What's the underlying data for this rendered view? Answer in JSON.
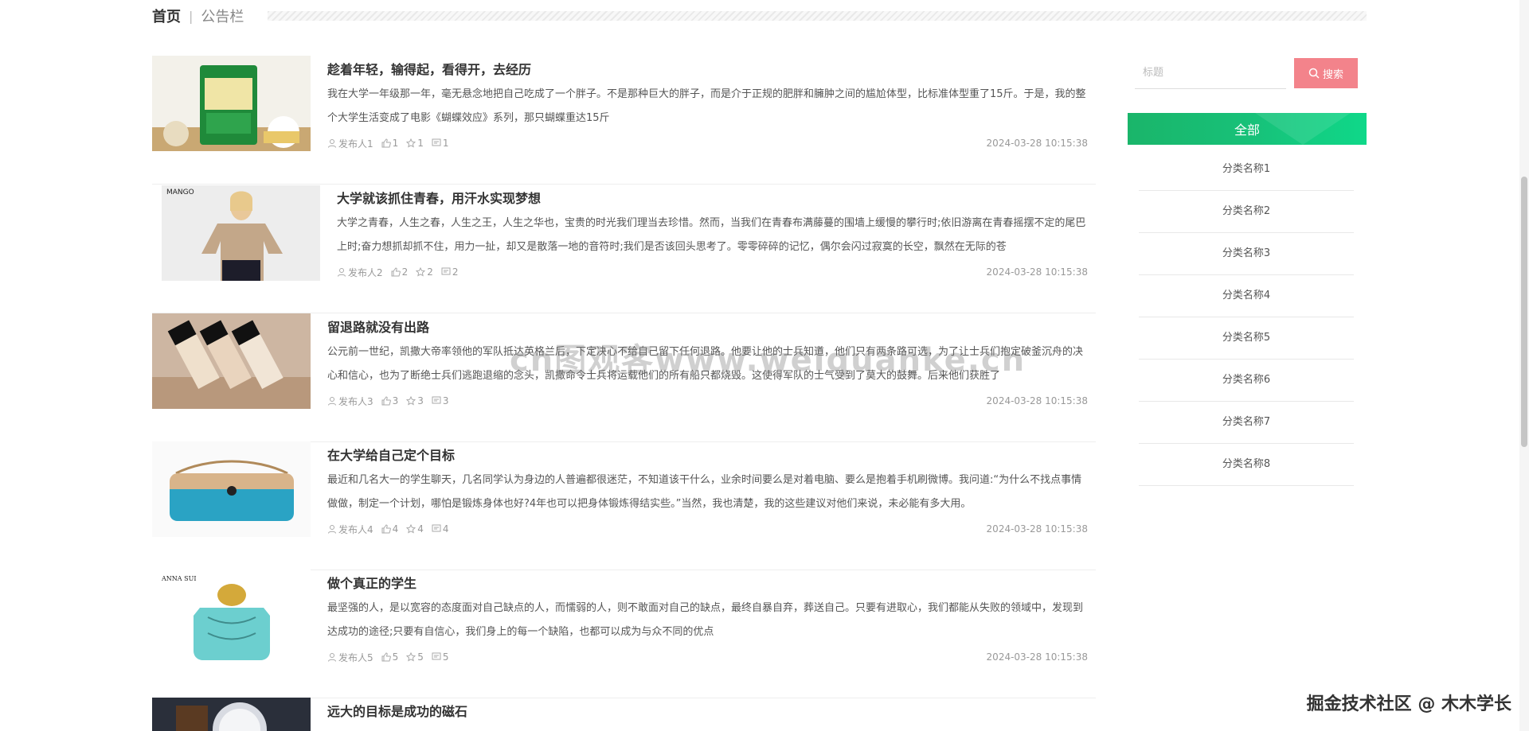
{
  "breadcrumb": {
    "home": "首页",
    "separator": "|",
    "current": "公告栏"
  },
  "articles": [
    {
      "title": "趁着年轻，输得起，看得开，去经历",
      "desc": "我在大学一年级那一年，毫无悬念地把自己吃成了一个胖子。不是那种巨大的胖子，而是介于正规的肥胖和臃肿之间的尴尬体型，比标准体型重了15斤。于是，我的整个大学生活变成了电影《蝴蝶效应》系列，那只蝴蝶重达15斤",
      "author": "发布人1",
      "likes": "1",
      "favs": "1",
      "comments": "1",
      "date": "2024-03-28 10:15:38",
      "thumb_icon": "oil-bottle-image"
    },
    {
      "title": "大学就该抓住青春，用汗水实现梦想",
      "desc": "大学之青春，人生之春，人生之王，人生之华也，宝贵的时光我们理当去珍惜。然而，当我们在青春布满藤蔓的围墙上缓慢的攀行时;依旧游离在青春摇摆不定的尾巴上时;奋力想抓却抓不住，用力一扯，却又是散落一地的音符时;我们是否该回头思考了。零零碎碎的记忆，偶尔会闪过寂寞的长空，飘然在无际的苍",
      "author": "发布人2",
      "likes": "2",
      "favs": "2",
      "comments": "2",
      "date": "2024-03-28 10:15:38",
      "thumb_icon": "fashion-model-image",
      "thumb_label": "MANGO"
    },
    {
      "title": "留退路就没有出路",
      "desc": "公元前一世纪，凯撒大帝率领他的军队抵达英格兰后，下定决心不给自己留下任何退路。他要让他的士兵知道，他们只有两条路可选，为了让士兵们抱定破釜沉舟的决心和信心，也为了断绝士兵们逃跑退缩的念头，凯撒命令士兵将运载他们的所有船只都烧毁。这使得军队的士气受到了莫大的鼓舞。后来他们获胜了",
      "author": "发布人3",
      "likes": "3",
      "favs": "3",
      "comments": "3",
      "date": "2024-03-28 10:15:38",
      "thumb_icon": "cosmetics-bottles-image"
    },
    {
      "title": "在大学给自己定个目标",
      "desc": "最近和几名大一的学生聊天，几名同学认为身边的人普遍都很迷茫，不知道该干什么，业余时间要么是对着电脑、要么是抱着手机刷微博。我问道:“为什么不找点事情做做，制定一个计划，哪怕是锻炼身体也好?4年也可以把身体锻炼得结实些。”当然，我也清楚，我的这些建议对他们来说，未必能有多大用。",
      "author": "发布人4",
      "likes": "4",
      "favs": "4",
      "comments": "4",
      "date": "2024-03-28 10:15:38",
      "thumb_icon": "handbag-image"
    },
    {
      "title": "做个真正的学生",
      "desc": "最坚强的人，是以宽容的态度面对自己缺点的人，而懦弱的人，则不敢面对自己的缺点，最终自暴自弃，葬送自己。只要有进取心，我们都能从失败的领域中，发现到达成功的途径;只要有自信心，我们身上的每一个缺陷，也都可以成为与众不同的优点",
      "author": "发布人5",
      "likes": "5",
      "favs": "5",
      "comments": "5",
      "date": "2024-03-28 10:15:38",
      "thumb_icon": "perfume-bottle-image",
      "thumb_label": "ANNA SUI"
    },
    {
      "title": "远大的目标是成功的磁石",
      "desc": "",
      "author": "",
      "likes": "",
      "favs": "",
      "comments": "",
      "date": "",
      "thumb_icon": "watch-image"
    }
  ],
  "search": {
    "placeholder": "标题",
    "button": "搜索"
  },
  "categories": {
    "all": "全部",
    "items": [
      "分类名称1",
      "分类名称2",
      "分类名称3",
      "分类名称4",
      "分类名称5",
      "分类名称6",
      "分类名称7",
      "分类名称8"
    ]
  },
  "watermark": "cn图观客www.weiquanke.cn",
  "attribution": "掘金技术社区 @ 木木学长",
  "colors": {
    "accent_green": "#1ab56a",
    "search_button": "#f3838b"
  }
}
